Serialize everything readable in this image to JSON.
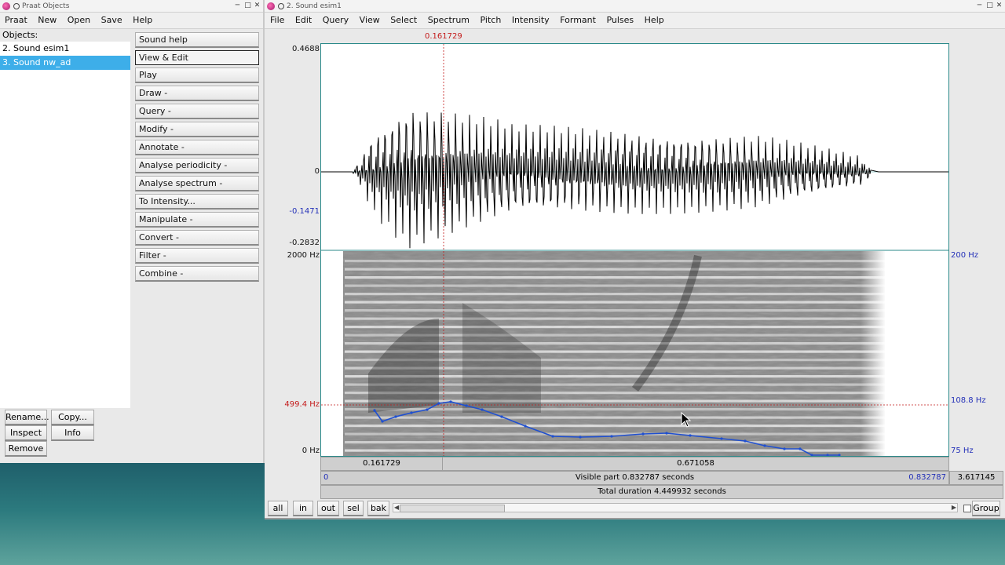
{
  "objects_window": {
    "title": "Praat Objects",
    "menu": [
      "Praat",
      "New",
      "Open",
      "Save",
      "Help"
    ],
    "objects_label": "Objects:",
    "objects": [
      "2. Sound esim1",
      "3. Sound nw_ad"
    ],
    "selected_index": 1,
    "dynamic_menu": [
      "Sound help",
      "View & Edit",
      "Play",
      "Draw -",
      "Query -",
      "Modify -",
      "Annotate -",
      "Analyse periodicity -",
      "Analyse spectrum -",
      "To Intensity...",
      "Manipulate -",
      "Convert -",
      "Filter -",
      "Combine -"
    ],
    "focused_button": "View & Edit",
    "bottom_buttons": {
      "rename": "Rename...",
      "copy": "Copy...",
      "inspect": "Inspect",
      "info": "Info",
      "remove": "Remove"
    }
  },
  "editor_window": {
    "title": "2. Sound esim1",
    "menu": [
      "File",
      "Edit",
      "Query",
      "View",
      "Select",
      "Spectrum",
      "Pitch",
      "Intensity",
      "Formant",
      "Pulses",
      "Help"
    ],
    "cursor_time": "0.161729",
    "waveform_axis": {
      "max": "0.4688",
      "zero": "0",
      "cursor_value": "-0.1471",
      "min": "-0.2832"
    },
    "spectrogram_axis": {
      "top": "2000 Hz",
      "cursor_freq": "499.4 Hz",
      "bottom": "0 Hz"
    },
    "pitch_axis": {
      "top": "200 Hz",
      "cursor_pitch": "108.8 Hz",
      "bottom": "75 Hz"
    },
    "time_bar": {
      "left_segment": "0.161729",
      "right_segment": "0.671058"
    },
    "visible_bar": {
      "start": "0",
      "label": "Visible part 0.832787 seconds",
      "end": "0.832787",
      "after": "3.617145"
    },
    "total_bar": {
      "label": "Total duration 4.449932 seconds"
    },
    "buttons": {
      "all": "all",
      "in": "in",
      "out": "out",
      "sel": "sel",
      "bak": "bak",
      "group": "Group"
    },
    "colors": {
      "waveform": "#000000",
      "cursor": "#c41b1b",
      "pitch": "#1f4fd0",
      "axis_blue": "#2330b8"
    }
  }
}
